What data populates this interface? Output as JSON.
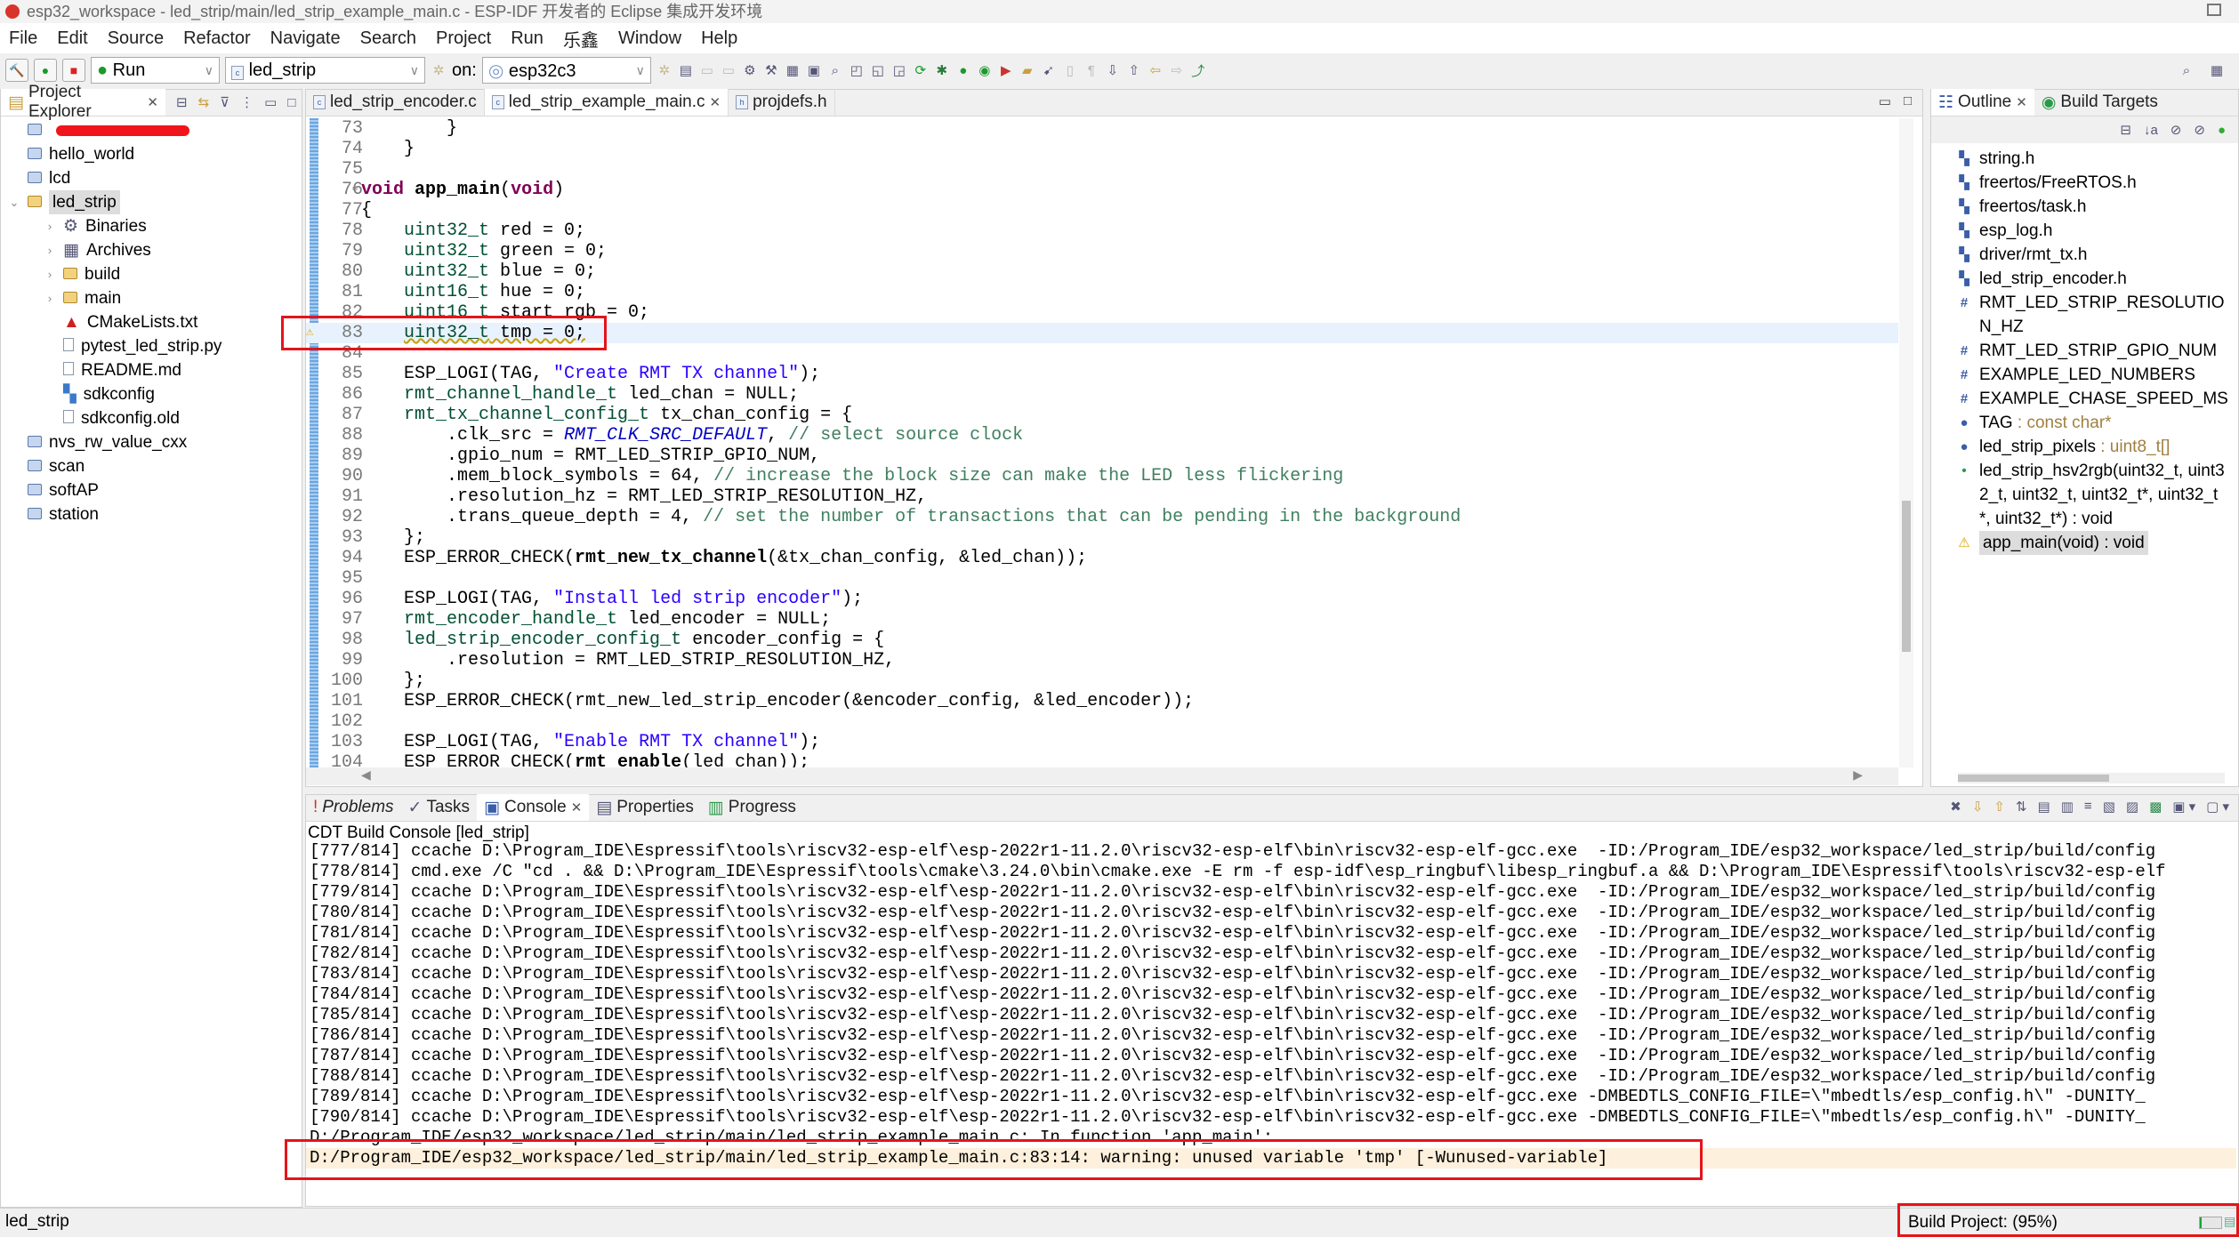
{
  "window": {
    "title": "esp32_workspace - led_strip/main/led_strip_example_main.c - ESP-IDF 开发者的 Eclipse 集成开发环境"
  },
  "menu": [
    "File",
    "Edit",
    "Source",
    "Refactor",
    "Navigate",
    "Search",
    "Project",
    "Run",
    "乐鑫",
    "Window",
    "Help"
  ],
  "toolbar": {
    "mode": "Run",
    "project": "led_strip",
    "on_label": "on:",
    "target": "esp32c3"
  },
  "explorer": {
    "title": "Project Explorer",
    "items": [
      {
        "label": "",
        "depth": 0,
        "icon": "folder-icon",
        "redacted": true
      },
      {
        "label": "hello_world",
        "depth": 0,
        "icon": "folder-icon"
      },
      {
        "label": "lcd",
        "depth": 0,
        "icon": "folder-icon"
      },
      {
        "label": "led_strip",
        "depth": 0,
        "icon": "c-project-icon",
        "expanded": true,
        "selected": true
      },
      {
        "label": "Binaries",
        "depth": 1,
        "icon": "binaries-icon",
        "collapsed": true
      },
      {
        "label": "Archives",
        "depth": 1,
        "icon": "archives-icon",
        "collapsed": true
      },
      {
        "label": "build",
        "depth": 1,
        "icon": "open-folder-icon",
        "collapsed": true
      },
      {
        "label": "main",
        "depth": 1,
        "icon": "open-folder-icon",
        "collapsed": true
      },
      {
        "label": "CMakeLists.txt",
        "depth": 1,
        "icon": "cmake-icon"
      },
      {
        "label": "pytest_led_strip.py",
        "depth": 1,
        "icon": "file-icon"
      },
      {
        "label": "README.md",
        "depth": 1,
        "icon": "file-icon"
      },
      {
        "label": "sdkconfig",
        "depth": 1,
        "icon": "config-icon"
      },
      {
        "label": "sdkconfig.old",
        "depth": 1,
        "icon": "file-icon"
      },
      {
        "label": "nvs_rw_value_cxx",
        "depth": 0,
        "icon": "folder-icon"
      },
      {
        "label": "scan",
        "depth": 0,
        "icon": "folder-icon"
      },
      {
        "label": "softAP",
        "depth": 0,
        "icon": "folder-icon"
      },
      {
        "label": "station",
        "depth": 0,
        "icon": "folder-icon"
      }
    ]
  },
  "editor": {
    "tabs": [
      {
        "label": "led_strip_encoder.c"
      },
      {
        "label": "led_strip_example_main.c",
        "active": true
      },
      {
        "label": "projdefs.h"
      }
    ],
    "current_line": 83,
    "warning_line": 83,
    "lines": [
      {
        "n": "73",
        "t": [
          [
            "        }",
            ""
          ]
        ]
      },
      {
        "n": "74",
        "t": [
          [
            "    }",
            ""
          ]
        ]
      },
      {
        "n": "75",
        "t": []
      },
      {
        "n": "76",
        "t": [
          [
            "void",
            "kw"
          ],
          [
            " ",
            ""
          ],
          [
            "app_main",
            "fn"
          ],
          [
            "(",
            ""
          ],
          [
            "void",
            "kw"
          ],
          [
            ")",
            ""
          ]
        ]
      },
      {
        "n": "77",
        "t": [
          [
            "{",
            ""
          ]
        ]
      },
      {
        "n": "78",
        "t": [
          [
            "    ",
            ""
          ],
          [
            "uint32_t",
            "ty"
          ],
          [
            " red = 0;",
            ""
          ]
        ]
      },
      {
        "n": "79",
        "t": [
          [
            "    ",
            ""
          ],
          [
            "uint32_t",
            "ty"
          ],
          [
            " green = 0;",
            ""
          ]
        ]
      },
      {
        "n": "80",
        "t": [
          [
            "    ",
            ""
          ],
          [
            "uint32_t",
            "ty"
          ],
          [
            " blue = 0;",
            ""
          ]
        ]
      },
      {
        "n": "81",
        "t": [
          [
            "    ",
            ""
          ],
          [
            "uint16_t",
            "ty"
          ],
          [
            " hue = 0;",
            ""
          ]
        ]
      },
      {
        "n": "82",
        "t": [
          [
            "    ",
            ""
          ],
          [
            "uint16_t",
            "ty"
          ],
          [
            " start_rgb = 0;",
            ""
          ]
        ]
      },
      {
        "n": "83",
        "t": [
          [
            "    ",
            ""
          ],
          [
            "uint32_t",
            "ty warn"
          ],
          [
            " tmp = 0;",
            "warn"
          ]
        ]
      },
      {
        "n": "84",
        "t": []
      },
      {
        "n": "85",
        "t": [
          [
            "    ESP_LOGI(TAG, ",
            ""
          ],
          [
            "\"Create RMT TX channel\"",
            "st"
          ],
          [
            ");",
            ""
          ]
        ]
      },
      {
        "n": "86",
        "t": [
          [
            "    ",
            ""
          ],
          [
            "rmt_channel_handle_t",
            "ty"
          ],
          [
            " led_chan = NULL;",
            ""
          ]
        ]
      },
      {
        "n": "87",
        "t": [
          [
            "    ",
            ""
          ],
          [
            "rmt_tx_channel_config_t",
            "ty"
          ],
          [
            " tx_chan_config = {",
            ""
          ]
        ]
      },
      {
        "n": "88",
        "t": [
          [
            "        .clk_src = ",
            ""
          ],
          [
            "RMT_CLK_SRC_DEFAULT",
            "en"
          ],
          [
            ", ",
            ""
          ],
          [
            "// select source clock",
            "cm"
          ]
        ]
      },
      {
        "n": "89",
        "t": [
          [
            "        .gpio_num = RMT_LED_STRIP_GPIO_NUM,",
            ""
          ]
        ]
      },
      {
        "n": "90",
        "t": [
          [
            "        .mem_block_symbols = 64, ",
            ""
          ],
          [
            "// increase the block size can make the LED less flickering",
            "cm"
          ]
        ]
      },
      {
        "n": "91",
        "t": [
          [
            "        .resolution_hz = RMT_LED_STRIP_RESOLUTION_HZ,",
            ""
          ]
        ]
      },
      {
        "n": "92",
        "t": [
          [
            "        .trans_queue_depth = 4, ",
            ""
          ],
          [
            "// set the number of transactions that can be pending in the background",
            "cm"
          ]
        ]
      },
      {
        "n": "93",
        "t": [
          [
            "    };",
            ""
          ]
        ]
      },
      {
        "n": "94",
        "t": [
          [
            "    ESP_ERROR_CHECK(",
            ""
          ],
          [
            "rmt_new_tx_channel",
            "fn"
          ],
          [
            "(&tx_chan_config, &led_chan));",
            ""
          ]
        ]
      },
      {
        "n": "95",
        "t": []
      },
      {
        "n": "96",
        "t": [
          [
            "    ESP_LOGI(TAG, ",
            ""
          ],
          [
            "\"Install led strip encoder\"",
            "st"
          ],
          [
            ");",
            ""
          ]
        ]
      },
      {
        "n": "97",
        "t": [
          [
            "    ",
            ""
          ],
          [
            "rmt_encoder_handle_t",
            "ty"
          ],
          [
            " led_encoder = NULL;",
            ""
          ]
        ]
      },
      {
        "n": "98",
        "t": [
          [
            "    ",
            ""
          ],
          [
            "led_strip_encoder_config_t",
            "ty"
          ],
          [
            " encoder_config = {",
            ""
          ]
        ]
      },
      {
        "n": "99",
        "t": [
          [
            "        .resolution = RMT_LED_STRIP_RESOLUTION_HZ,",
            ""
          ]
        ]
      },
      {
        "n": "100",
        "t": [
          [
            "    };",
            ""
          ]
        ]
      },
      {
        "n": "101",
        "t": [
          [
            "    ESP_ERROR_CHECK(rmt_new_led_strip_encoder(&encoder_config, &led_encoder));",
            ""
          ]
        ]
      },
      {
        "n": "102",
        "t": []
      },
      {
        "n": "103",
        "t": [
          [
            "    ESP_LOGI(TAG, ",
            ""
          ],
          [
            "\"Enable RMT TX channel\"",
            "st"
          ],
          [
            ");",
            ""
          ]
        ]
      },
      {
        "n": "104",
        "t": [
          [
            "    ESP_ERROR_CHECK(",
            ""
          ],
          [
            "rmt_enable",
            "fn"
          ],
          [
            "(led_chan));",
            ""
          ]
        ]
      }
    ]
  },
  "outline": {
    "tabs": [
      {
        "label": "Outline",
        "active": true
      },
      {
        "label": "Build Targets"
      }
    ],
    "items": [
      {
        "label": "string.h",
        "icon": "include-icon"
      },
      {
        "label": "freertos/FreeRTOS.h",
        "icon": "include-icon"
      },
      {
        "label": "freertos/task.h",
        "icon": "include-icon"
      },
      {
        "label": "esp_log.h",
        "icon": "include-icon"
      },
      {
        "label": "driver/rmt_tx.h",
        "icon": "include-icon"
      },
      {
        "label": "led_strip_encoder.h",
        "icon": "include-icon"
      },
      {
        "label": "RMT_LED_STRIP_RESOLUTION_HZ",
        "icon": "macro-icon"
      },
      {
        "label": "RMT_LED_STRIP_GPIO_NUM",
        "icon": "macro-icon"
      },
      {
        "label": "EXAMPLE_LED_NUMBERS",
        "icon": "macro-icon"
      },
      {
        "label": "EXAMPLE_CHASE_SPEED_MS",
        "icon": "macro-icon"
      },
      {
        "label": "TAG",
        "type": " : const char*",
        "icon": "static-const-variable-icon"
      },
      {
        "label": "led_strip_pixels",
        "type": " : uint8_t[]",
        "icon": "static-variable-icon"
      },
      {
        "label": "led_strip_hsv2rgb(uint32_t, uint32_t, uint32_t, uint32_t*, uint32_t*, uint32_t*) : void",
        "icon": "function-icon"
      },
      {
        "label": "app_main(void) : void",
        "icon": "function-warning-icon",
        "selected": true
      }
    ]
  },
  "bottom": {
    "tabs": [
      {
        "label": "Problems"
      },
      {
        "label": "Tasks"
      },
      {
        "label": "Console",
        "active": true
      },
      {
        "label": "Properties"
      },
      {
        "label": "Progress"
      }
    ],
    "console_title": "CDT Build Console [led_strip]",
    "lines": [
      "[777/814] ccache D:\\Program_IDE\\Espressif\\tools\\riscv32-esp-elf\\esp-2022r1-11.2.0\\riscv32-esp-elf\\bin\\riscv32-esp-elf-gcc.exe  -ID:/Program_IDE/esp32_workspace/led_strip/build/config",
      "[778/814] cmd.exe /C \"cd . && D:\\Program_IDE\\Espressif\\tools\\cmake\\3.24.0\\bin\\cmake.exe -E rm -f esp-idf\\esp_ringbuf\\libesp_ringbuf.a && D:\\Program_IDE\\Espressif\\tools\\riscv32-esp-elf",
      "[779/814] ccache D:\\Program_IDE\\Espressif\\tools\\riscv32-esp-elf\\esp-2022r1-11.2.0\\riscv32-esp-elf\\bin\\riscv32-esp-elf-gcc.exe  -ID:/Program_IDE/esp32_workspace/led_strip/build/config",
      "[780/814] ccache D:\\Program_IDE\\Espressif\\tools\\riscv32-esp-elf\\esp-2022r1-11.2.0\\riscv32-esp-elf\\bin\\riscv32-esp-elf-gcc.exe  -ID:/Program_IDE/esp32_workspace/led_strip/build/config",
      "[781/814] ccache D:\\Program_IDE\\Espressif\\tools\\riscv32-esp-elf\\esp-2022r1-11.2.0\\riscv32-esp-elf\\bin\\riscv32-esp-elf-gcc.exe  -ID:/Program_IDE/esp32_workspace/led_strip/build/config",
      "[782/814] ccache D:\\Program_IDE\\Espressif\\tools\\riscv32-esp-elf\\esp-2022r1-11.2.0\\riscv32-esp-elf\\bin\\riscv32-esp-elf-gcc.exe  -ID:/Program_IDE/esp32_workspace/led_strip/build/config",
      "[783/814] ccache D:\\Program_IDE\\Espressif\\tools\\riscv32-esp-elf\\esp-2022r1-11.2.0\\riscv32-esp-elf\\bin\\riscv32-esp-elf-gcc.exe  -ID:/Program_IDE/esp32_workspace/led_strip/build/config",
      "[784/814] ccache D:\\Program_IDE\\Espressif\\tools\\riscv32-esp-elf\\esp-2022r1-11.2.0\\riscv32-esp-elf\\bin\\riscv32-esp-elf-gcc.exe  -ID:/Program_IDE/esp32_workspace/led_strip/build/config",
      "[785/814] ccache D:\\Program_IDE\\Espressif\\tools\\riscv32-esp-elf\\esp-2022r1-11.2.0\\riscv32-esp-elf\\bin\\riscv32-esp-elf-gcc.exe  -ID:/Program_IDE/esp32_workspace/led_strip/build/config",
      "[786/814] ccache D:\\Program_IDE\\Espressif\\tools\\riscv32-esp-elf\\esp-2022r1-11.2.0\\riscv32-esp-elf\\bin\\riscv32-esp-elf-gcc.exe  -ID:/Program_IDE/esp32_workspace/led_strip/build/config",
      "[787/814] ccache D:\\Program_IDE\\Espressif\\tools\\riscv32-esp-elf\\esp-2022r1-11.2.0\\riscv32-esp-elf\\bin\\riscv32-esp-elf-gcc.exe  -ID:/Program_IDE/esp32_workspace/led_strip/build/config",
      "[788/814] ccache D:\\Program_IDE\\Espressif\\tools\\riscv32-esp-elf\\esp-2022r1-11.2.0\\riscv32-esp-elf\\bin\\riscv32-esp-elf-gcc.exe  -ID:/Program_IDE/esp32_workspace/led_strip/build/config",
      "[789/814] ccache D:\\Program_IDE\\Espressif\\tools\\riscv32-esp-elf\\esp-2022r1-11.2.0\\riscv32-esp-elf\\bin\\riscv32-esp-elf-gcc.exe -DMBEDTLS_CONFIG_FILE=\\\"mbedtls/esp_config.h\\\" -DUNITY_",
      "[790/814] ccache D:\\Program_IDE\\Espressif\\tools\\riscv32-esp-elf\\esp-2022r1-11.2.0\\riscv32-esp-elf\\bin\\riscv32-esp-elf-gcc.exe -DMBEDTLS_CONFIG_FILE=\\\"mbedtls/esp_config.h\\\" -DUNITY_",
      "D:/Program_IDE/esp32_workspace/led_strip/main/led_strip_example_main.c: In function 'app_main':",
      "D:/Program_IDE/esp32_workspace/led_strip/main/led_strip_example_main.c:83:14: warning: unused variable 'tmp' [-Wunused-variable]"
    ],
    "warning_index": 15
  },
  "status": {
    "left": "led_strip",
    "progress_label": "Build Project: (95%)",
    "progress_percent": 95
  },
  "colors": {
    "highlight": "#e4141b",
    "keyword": "#7f0055",
    "string": "#2a00ff",
    "comment": "#3f7f5f",
    "warning_bg": "#fdf0dc"
  }
}
